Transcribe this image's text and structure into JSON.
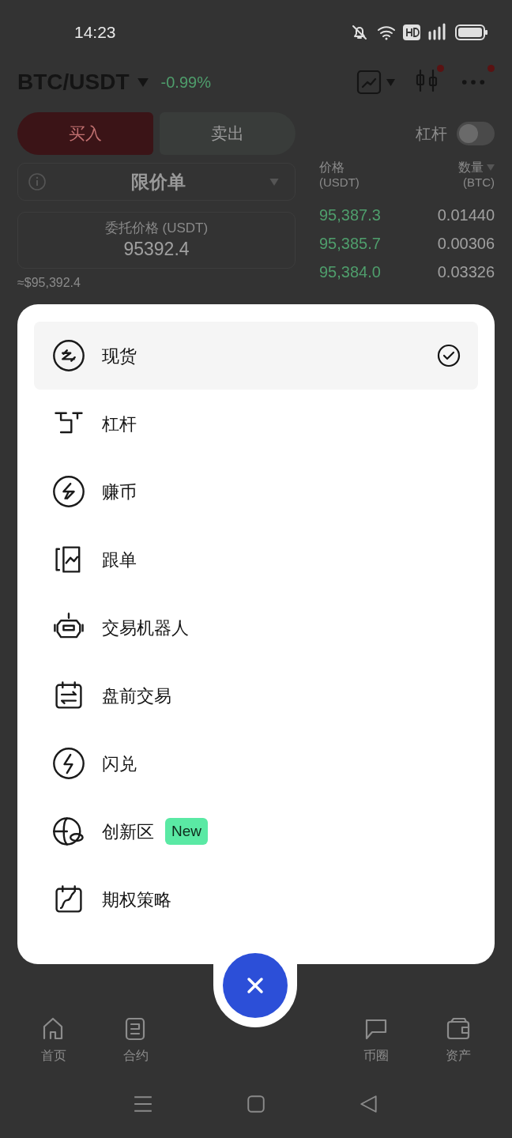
{
  "status_bar": {
    "time": "14:23"
  },
  "header": {
    "pair": "BTC/USDT",
    "change": "-0.99%"
  },
  "side_tabs": [
    {
      "label": "买入",
      "selected": true
    },
    {
      "label": "卖出",
      "selected": false
    }
  ],
  "leverage": {
    "label": "杠杆",
    "on": false
  },
  "order_type": "限价单",
  "price_field": {
    "label": "委托价格 (USDT)",
    "value": "95392.4"
  },
  "approx_value": "≈$95,392.4",
  "order_book": {
    "columns": [
      {
        "label": "价格",
        "unit": "(USDT)"
      },
      {
        "label": "数量",
        "unit": "(BTC)"
      }
    ],
    "rows": [
      {
        "price": "95,387.3",
        "amount": "0.01440"
      },
      {
        "price": "95,385.7",
        "amount": "0.00306"
      },
      {
        "price": "95,384.0",
        "amount": "0.03326"
      }
    ]
  },
  "menu": {
    "items": [
      {
        "label": "现货",
        "selected": true
      },
      {
        "label": "杠杆",
        "selected": false
      },
      {
        "label": "赚币",
        "selected": false
      },
      {
        "label": "跟单",
        "selected": false
      },
      {
        "label": "交易机器人",
        "selected": false
      },
      {
        "label": "盘前交易",
        "selected": false
      },
      {
        "label": "闪兑",
        "selected": false
      },
      {
        "label": "创新区",
        "selected": false,
        "badge": "New"
      },
      {
        "label": "期权策略",
        "selected": false
      }
    ]
  },
  "bottom_nav": [
    {
      "label": "首页"
    },
    {
      "label": "合约"
    },
    {
      "label": "币圈"
    },
    {
      "label": "资产"
    }
  ]
}
